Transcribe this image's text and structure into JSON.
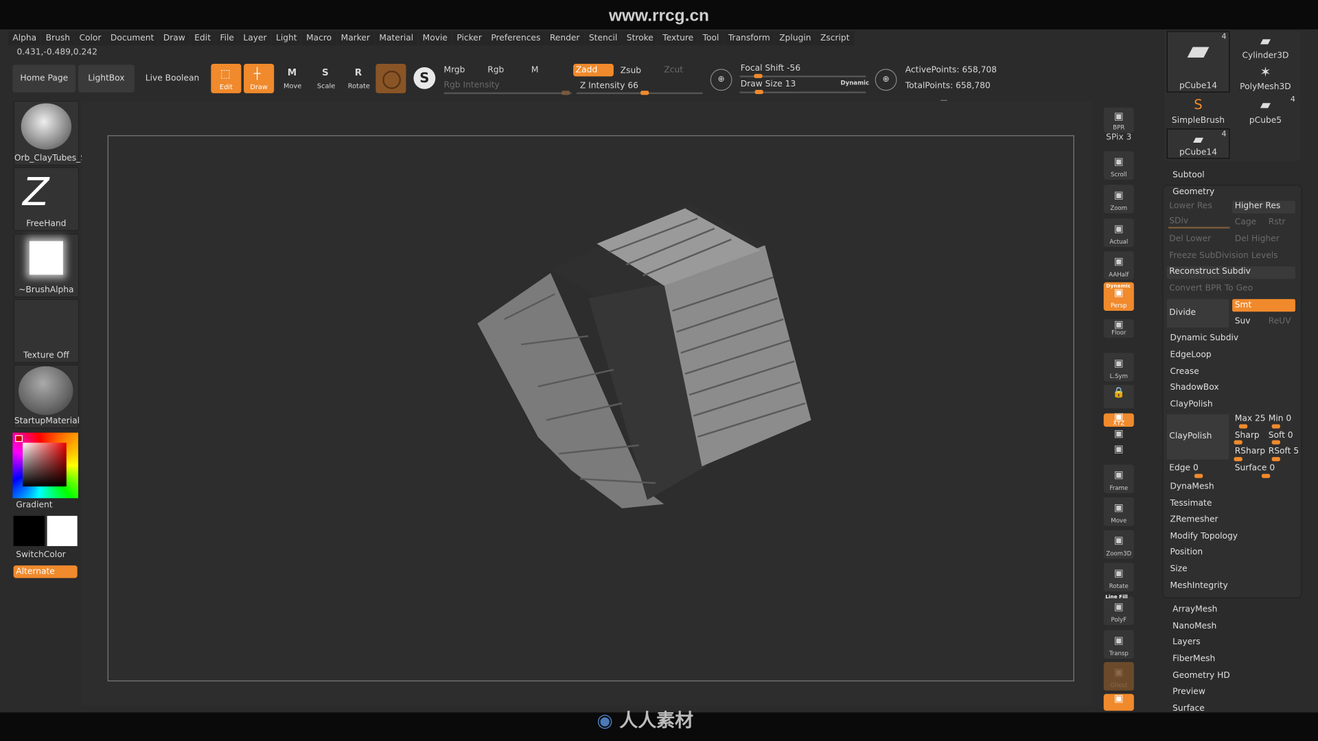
{
  "watermark": {
    "site": "www.rrcg.cn",
    "logo": "人人素材"
  },
  "menu": [
    "Alpha",
    "Brush",
    "Color",
    "Document",
    "Draw",
    "Edit",
    "File",
    "Layer",
    "Light",
    "Macro",
    "Marker",
    "Material",
    "Movie",
    "Picker",
    "Preferences",
    "Render",
    "Stencil",
    "Stroke",
    "Texture",
    "Tool",
    "Transform",
    "Zplugin",
    "Zscript"
  ],
  "coords": "0.431,-0.489,0.242",
  "toolbar": {
    "home_page": "Home Page",
    "lightbox": "LightBox",
    "live_boolean": "Live Boolean",
    "edit": "Edit",
    "draw": "Draw",
    "move": "Move",
    "scale": "Scale",
    "rotate": "Rotate",
    "mrgb": "Mrgb",
    "rgb": "Rgb",
    "m": "M",
    "rgb_intensity": "Rgb Intensity",
    "zadd": "Zadd",
    "zsub": "Zsub",
    "zcut": "Zcut",
    "z_intensity": "Z Intensity 66",
    "focal_shift": "Focal Shift -56",
    "draw_size": "Draw Size 13",
    "dynamic": "Dynamic",
    "active_points": "ActivePoints: 658,708",
    "total_points": "TotalPoints: 658,780",
    "z_intensity_value": 66,
    "focal_shift_value": -56,
    "draw_size_value": 13
  },
  "shelf": {
    "brush": "Orb_ClayTubes_S",
    "stroke": "FreeHand",
    "alpha": "~BrushAlpha",
    "texture": "Texture Off",
    "material": "StartupMaterial",
    "gradient": "Gradient",
    "switch_color": "SwitchColor",
    "alternate": "Alternate"
  },
  "colors": {
    "accent": "#f08a2c",
    "main_color": "#000000",
    "secondary_color": "#ffffff"
  },
  "right_tools": [
    "BPR",
    "SPix 3",
    "Scroll",
    "Zoom",
    "Actual",
    "AAHalf",
    "Persp",
    "Floor",
    "L.Sym",
    "",
    "XYZ",
    "",
    "",
    "Frame",
    "Move",
    "Zoom3D",
    "Rotate",
    "PolyF",
    "Transp",
    "Ghost",
    ""
  ],
  "right_tool_extra": {
    "dynamic": "Dynamic",
    "line_fill": "Line Fill"
  },
  "subtools": [
    {
      "name": "pCube14",
      "count": "4"
    },
    {
      "name": "Cylinder3D",
      "count": ""
    },
    {
      "name": "PolyMesh3D",
      "count": ""
    },
    {
      "name": "SimpleBrush",
      "count": ""
    },
    {
      "name": "pCube5",
      "count": "4"
    },
    {
      "name": "pCube14",
      "count": "4"
    }
  ],
  "panel": {
    "subtool": "Subtool",
    "geometry": "Geometry",
    "lower_res": "Lower Res",
    "higher_res": "Higher Res",
    "sdiv": "SDiv",
    "cage": "Cage",
    "rstr": "Rstr",
    "del_lower": "Del Lower",
    "del_higher": "Del Higher",
    "freeze": "Freeze SubDivision Levels",
    "reconstruct": "Reconstruct Subdiv",
    "convert_bpr": "Convert BPR To Geo",
    "divide": "Divide",
    "smt": "Smt",
    "suv": "Suv",
    "reuv": "ReUV",
    "items1": [
      "Dynamic Subdiv",
      "EdgeLoop",
      "Crease",
      "ShadowBox"
    ],
    "claypolish_header": "ClayPolish",
    "claypolish_btn": "ClayPolish",
    "max": "Max 25",
    "min": "Min 0",
    "sharp": "Sharp",
    "soft": "Soft 0",
    "rsharp": "RSharp",
    "rsoft": "RSoft 5",
    "edge": "Edge 0",
    "surface": "Surface 0",
    "items2": [
      "DynaMesh",
      "Tessimate",
      "ZRemesher",
      "Modify Topology",
      "Position",
      "Size",
      "MeshIntegrity"
    ],
    "items3": [
      "ArrayMesh",
      "NanoMesh",
      "Layers",
      "FiberMesh",
      "Geometry HD",
      "Preview",
      "Surface"
    ]
  }
}
